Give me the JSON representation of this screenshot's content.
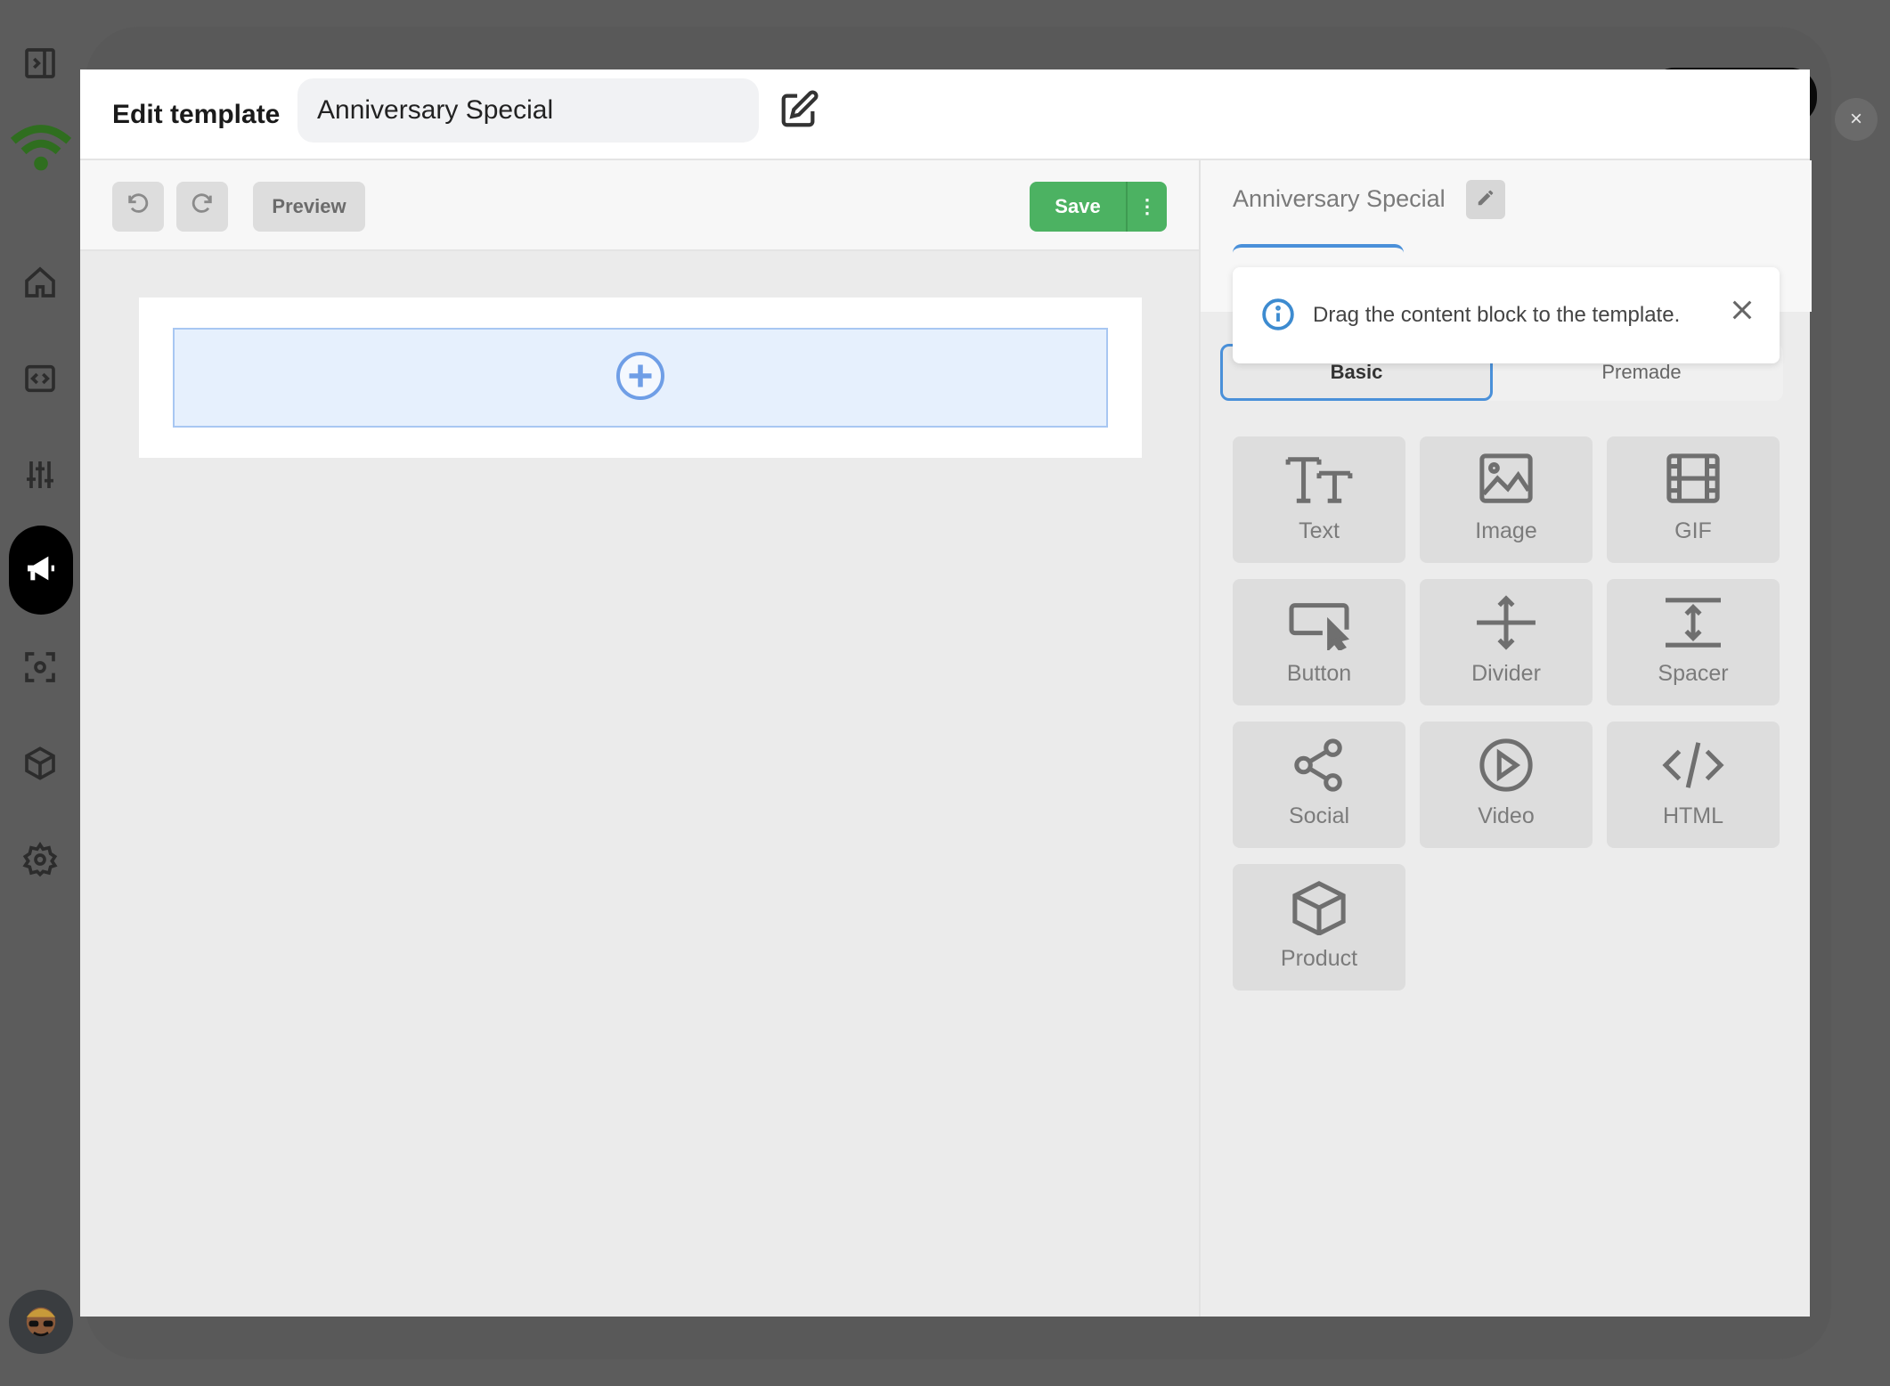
{
  "modal": {
    "title": "Edit template",
    "template_name": "Anniversary Special"
  },
  "toolbar": {
    "preview_label": "Preview",
    "save_label": "Save",
    "more_label": "⋮"
  },
  "right_panel": {
    "template_name": "Anniversary Special",
    "tooltip_message": "Drag the content block to the template.",
    "tabs": [
      {
        "label": "Basic",
        "active": true
      },
      {
        "label": "Premade",
        "active": false
      }
    ],
    "blocks": [
      {
        "label": "Text",
        "icon": "text-icon"
      },
      {
        "label": "Image",
        "icon": "image-icon"
      },
      {
        "label": "GIF",
        "icon": "gif-icon"
      },
      {
        "label": "Button",
        "icon": "button-icon"
      },
      {
        "label": "Divider",
        "icon": "divider-icon"
      },
      {
        "label": "Spacer",
        "icon": "spacer-icon"
      },
      {
        "label": "Social",
        "icon": "share-icon"
      },
      {
        "label": "Video",
        "icon": "play-icon"
      },
      {
        "label": "HTML",
        "icon": "code-icon"
      },
      {
        "label": "Product",
        "icon": "box-icon"
      }
    ]
  },
  "outer_close_label": "×",
  "colors": {
    "accent_blue": "#4a90d9",
    "save_green": "#4cb262",
    "brand_green": "#2f6e1f",
    "backdrop": "#5c5c5c"
  }
}
